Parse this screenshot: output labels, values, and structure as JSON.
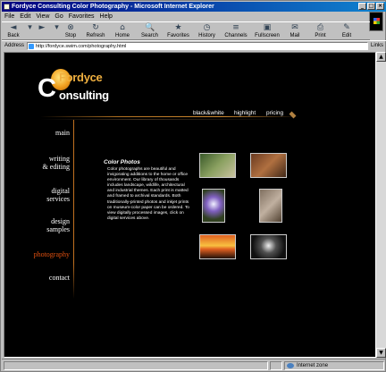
{
  "window": {
    "title": "Fordyce Consulting Color Photography - Microsoft Internet Explorer",
    "buttons": [
      "_",
      "□",
      "×"
    ]
  },
  "menu": [
    "File",
    "Edit",
    "View",
    "Go",
    "Favorites",
    "Help"
  ],
  "toolbar": [
    {
      "label": "Back",
      "icon": "back-arrow-icon",
      "glyph": "◄"
    },
    {
      "label": "",
      "icon": "back-dropdown-icon",
      "glyph": "▾"
    },
    {
      "label": "",
      "icon": "forward-arrow-icon",
      "glyph": "►"
    },
    {
      "label": "",
      "icon": "forward-dropdown-icon",
      "glyph": "▾"
    },
    {
      "label": "Stop",
      "icon": "stop-icon",
      "glyph": "⊗"
    },
    {
      "label": "Refresh",
      "icon": "refresh-icon",
      "glyph": "↻"
    },
    {
      "label": "Home",
      "icon": "home-icon",
      "glyph": "⌂"
    },
    {
      "label": "Search",
      "icon": "search-icon",
      "glyph": "🔍"
    },
    {
      "label": "Favorites",
      "icon": "favorites-icon",
      "glyph": "★"
    },
    {
      "label": "History",
      "icon": "history-icon",
      "glyph": "◷"
    },
    {
      "label": "Channels",
      "icon": "channels-icon",
      "glyph": "≡"
    },
    {
      "label": "Fullscreen",
      "icon": "fullscreen-icon",
      "glyph": "▣"
    },
    {
      "label": "Mail",
      "icon": "mail-icon",
      "glyph": "✉"
    },
    {
      "label": "Print",
      "icon": "print-icon",
      "glyph": "⎙"
    },
    {
      "label": "Edit",
      "icon": "edit-icon",
      "glyph": "✎"
    }
  ],
  "address": {
    "label": "Address",
    "url": "http://fordyce.swim.com/photography.html",
    "links_label": "Links"
  },
  "site": {
    "logo_initial_F": "F",
    "logo_initial_C": "C",
    "logo_line1": "ordyce",
    "logo_line2": "onsulting",
    "topnav": [
      "black&white",
      "highlight",
      "pricing"
    ],
    "sidenav": [
      {
        "label": "main",
        "active": false
      },
      {
        "label": "writing\n& editing",
        "active": false
      },
      {
        "label": "digital\nservices",
        "active": false
      },
      {
        "label": "design\nsamples",
        "active": false
      },
      {
        "label": "photography",
        "active": true
      },
      {
        "label": "contact",
        "active": false
      }
    ],
    "section_title": "Color Photos",
    "body": "Color photographs are beautiful and invigorating additions to the home or office environment. Our library of thousands includes landscape, wildlife, architectural and industrial themes. Each print is matted and framed to archival standards. Both traditionally-printed photos and inkjet prints on museum-color paper can be ordered. To view digitally processed images, click on digital services above.",
    "thumbnails": [
      {
        "name": "landscape-photo",
        "colors": [
          "#3a5a2a",
          "#8aa060",
          "#c9c2a0"
        ]
      },
      {
        "name": "industrial-photo",
        "colors": [
          "#6a3a20",
          "#b07040",
          "#402818"
        ]
      },
      {
        "name": "flower-photo",
        "colors": [
          "#304020",
          "#8060c0",
          "#f0f0ff"
        ]
      },
      {
        "name": "stone-carving-photo",
        "colors": [
          "#807060",
          "#c0b0a0",
          "#504030"
        ]
      },
      {
        "name": "sunset-photo",
        "colors": [
          "#201008",
          "#e06020",
          "#f8c040"
        ]
      },
      {
        "name": "lily-photo",
        "colors": [
          "#101010",
          "#505050",
          "#f0f0f0"
        ]
      }
    ]
  },
  "status": {
    "zone": "Internet zone"
  },
  "colors": {
    "accent_orange": "#e05010",
    "gold": "#f0b040",
    "title_blue": "#000080"
  }
}
